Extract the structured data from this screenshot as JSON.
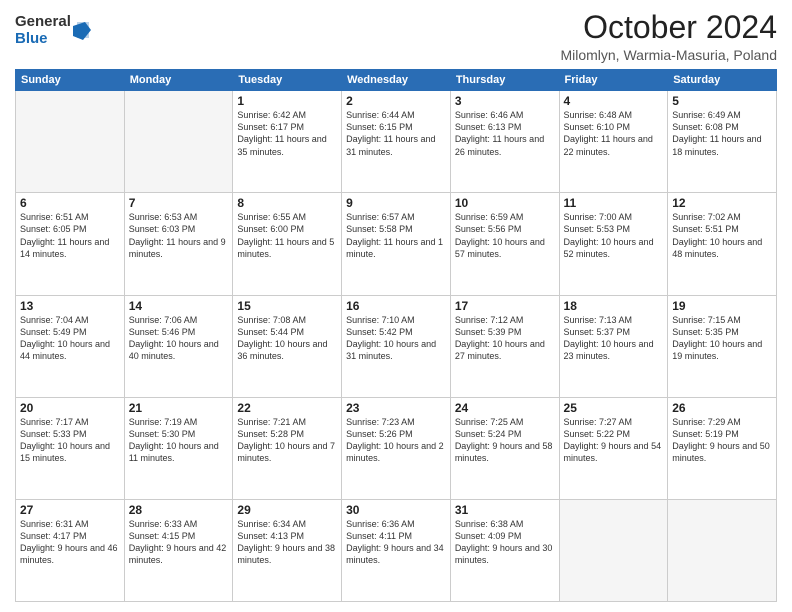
{
  "logo": {
    "general": "General",
    "blue": "Blue"
  },
  "header": {
    "month": "October 2024",
    "location": "Milomlyn, Warmia-Masuria, Poland"
  },
  "weekdays": [
    "Sunday",
    "Monday",
    "Tuesday",
    "Wednesday",
    "Thursday",
    "Friday",
    "Saturday"
  ],
  "weeks": [
    [
      {
        "day": "",
        "sunrise": "",
        "sunset": "",
        "daylight": ""
      },
      {
        "day": "",
        "sunrise": "",
        "sunset": "",
        "daylight": ""
      },
      {
        "day": "1",
        "sunrise": "Sunrise: 6:42 AM",
        "sunset": "Sunset: 6:17 PM",
        "daylight": "Daylight: 11 hours and 35 minutes."
      },
      {
        "day": "2",
        "sunrise": "Sunrise: 6:44 AM",
        "sunset": "Sunset: 6:15 PM",
        "daylight": "Daylight: 11 hours and 31 minutes."
      },
      {
        "day": "3",
        "sunrise": "Sunrise: 6:46 AM",
        "sunset": "Sunset: 6:13 PM",
        "daylight": "Daylight: 11 hours and 26 minutes."
      },
      {
        "day": "4",
        "sunrise": "Sunrise: 6:48 AM",
        "sunset": "Sunset: 6:10 PM",
        "daylight": "Daylight: 11 hours and 22 minutes."
      },
      {
        "day": "5",
        "sunrise": "Sunrise: 6:49 AM",
        "sunset": "Sunset: 6:08 PM",
        "daylight": "Daylight: 11 hours and 18 minutes."
      }
    ],
    [
      {
        "day": "6",
        "sunrise": "Sunrise: 6:51 AM",
        "sunset": "Sunset: 6:05 PM",
        "daylight": "Daylight: 11 hours and 14 minutes."
      },
      {
        "day": "7",
        "sunrise": "Sunrise: 6:53 AM",
        "sunset": "Sunset: 6:03 PM",
        "daylight": "Daylight: 11 hours and 9 minutes."
      },
      {
        "day": "8",
        "sunrise": "Sunrise: 6:55 AM",
        "sunset": "Sunset: 6:00 PM",
        "daylight": "Daylight: 11 hours and 5 minutes."
      },
      {
        "day": "9",
        "sunrise": "Sunrise: 6:57 AM",
        "sunset": "Sunset: 5:58 PM",
        "daylight": "Daylight: 11 hours and 1 minute."
      },
      {
        "day": "10",
        "sunrise": "Sunrise: 6:59 AM",
        "sunset": "Sunset: 5:56 PM",
        "daylight": "Daylight: 10 hours and 57 minutes."
      },
      {
        "day": "11",
        "sunrise": "Sunrise: 7:00 AM",
        "sunset": "Sunset: 5:53 PM",
        "daylight": "Daylight: 10 hours and 52 minutes."
      },
      {
        "day": "12",
        "sunrise": "Sunrise: 7:02 AM",
        "sunset": "Sunset: 5:51 PM",
        "daylight": "Daylight: 10 hours and 48 minutes."
      }
    ],
    [
      {
        "day": "13",
        "sunrise": "Sunrise: 7:04 AM",
        "sunset": "Sunset: 5:49 PM",
        "daylight": "Daylight: 10 hours and 44 minutes."
      },
      {
        "day": "14",
        "sunrise": "Sunrise: 7:06 AM",
        "sunset": "Sunset: 5:46 PM",
        "daylight": "Daylight: 10 hours and 40 minutes."
      },
      {
        "day": "15",
        "sunrise": "Sunrise: 7:08 AM",
        "sunset": "Sunset: 5:44 PM",
        "daylight": "Daylight: 10 hours and 36 minutes."
      },
      {
        "day": "16",
        "sunrise": "Sunrise: 7:10 AM",
        "sunset": "Sunset: 5:42 PM",
        "daylight": "Daylight: 10 hours and 31 minutes."
      },
      {
        "day": "17",
        "sunrise": "Sunrise: 7:12 AM",
        "sunset": "Sunset: 5:39 PM",
        "daylight": "Daylight: 10 hours and 27 minutes."
      },
      {
        "day": "18",
        "sunrise": "Sunrise: 7:13 AM",
        "sunset": "Sunset: 5:37 PM",
        "daylight": "Daylight: 10 hours and 23 minutes."
      },
      {
        "day": "19",
        "sunrise": "Sunrise: 7:15 AM",
        "sunset": "Sunset: 5:35 PM",
        "daylight": "Daylight: 10 hours and 19 minutes."
      }
    ],
    [
      {
        "day": "20",
        "sunrise": "Sunrise: 7:17 AM",
        "sunset": "Sunset: 5:33 PM",
        "daylight": "Daylight: 10 hours and 15 minutes."
      },
      {
        "day": "21",
        "sunrise": "Sunrise: 7:19 AM",
        "sunset": "Sunset: 5:30 PM",
        "daylight": "Daylight: 10 hours and 11 minutes."
      },
      {
        "day": "22",
        "sunrise": "Sunrise: 7:21 AM",
        "sunset": "Sunset: 5:28 PM",
        "daylight": "Daylight: 10 hours and 7 minutes."
      },
      {
        "day": "23",
        "sunrise": "Sunrise: 7:23 AM",
        "sunset": "Sunset: 5:26 PM",
        "daylight": "Daylight: 10 hours and 2 minutes."
      },
      {
        "day": "24",
        "sunrise": "Sunrise: 7:25 AM",
        "sunset": "Sunset: 5:24 PM",
        "daylight": "Daylight: 9 hours and 58 minutes."
      },
      {
        "day": "25",
        "sunrise": "Sunrise: 7:27 AM",
        "sunset": "Sunset: 5:22 PM",
        "daylight": "Daylight: 9 hours and 54 minutes."
      },
      {
        "day": "26",
        "sunrise": "Sunrise: 7:29 AM",
        "sunset": "Sunset: 5:19 PM",
        "daylight": "Daylight: 9 hours and 50 minutes."
      }
    ],
    [
      {
        "day": "27",
        "sunrise": "Sunrise: 6:31 AM",
        "sunset": "Sunset: 4:17 PM",
        "daylight": "Daylight: 9 hours and 46 minutes."
      },
      {
        "day": "28",
        "sunrise": "Sunrise: 6:33 AM",
        "sunset": "Sunset: 4:15 PM",
        "daylight": "Daylight: 9 hours and 42 minutes."
      },
      {
        "day": "29",
        "sunrise": "Sunrise: 6:34 AM",
        "sunset": "Sunset: 4:13 PM",
        "daylight": "Daylight: 9 hours and 38 minutes."
      },
      {
        "day": "30",
        "sunrise": "Sunrise: 6:36 AM",
        "sunset": "Sunset: 4:11 PM",
        "daylight": "Daylight: 9 hours and 34 minutes."
      },
      {
        "day": "31",
        "sunrise": "Sunrise: 6:38 AM",
        "sunset": "Sunset: 4:09 PM",
        "daylight": "Daylight: 9 hours and 30 minutes."
      },
      {
        "day": "",
        "sunrise": "",
        "sunset": "",
        "daylight": ""
      },
      {
        "day": "",
        "sunrise": "",
        "sunset": "",
        "daylight": ""
      }
    ]
  ]
}
